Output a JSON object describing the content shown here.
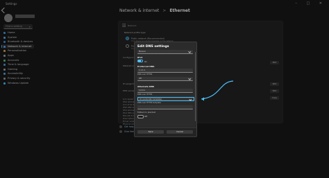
{
  "window": {
    "title": "Settings"
  },
  "sidebar": {
    "user_name": "",
    "search_placeholder": "Find a setting",
    "items": [
      {
        "label": "Home",
        "icon": "home-icon",
        "color": "#4aa0e8"
      },
      {
        "label": "System",
        "icon": "system-icon",
        "color": "#5ab0f0"
      },
      {
        "label": "Bluetooth & devices",
        "icon": "bluetooth-icon",
        "color": "#4a8fe0"
      },
      {
        "label": "Network & internet",
        "icon": "wifi-icon",
        "color": "#5fa8f2"
      },
      {
        "label": "Personalization",
        "icon": "brush-icon",
        "color": "#e0a860"
      },
      {
        "label": "Apps",
        "icon": "apps-icon",
        "color": "#9aa7b8"
      },
      {
        "label": "Accounts",
        "icon": "person-icon",
        "color": "#52c38a"
      },
      {
        "label": "Time & language",
        "icon": "clock-icon",
        "color": "#4fa2e6"
      },
      {
        "label": "Gaming",
        "icon": "gamepad-icon",
        "color": "#a8a8a8"
      },
      {
        "label": "Accessibility",
        "icon": "accessibility-icon",
        "color": "#5aa6ef"
      },
      {
        "label": "Privacy & security",
        "icon": "shield-icon",
        "color": "#9a9a9a"
      },
      {
        "label": "Windows Update",
        "icon": "update-icon",
        "color": "#4cc2ff"
      }
    ]
  },
  "breadcrumb": {
    "parent": "Network & internet",
    "separator": ">",
    "current": "Ethernet"
  },
  "ethernet_card": {
    "network_label": "Network",
    "profile_type_label": "Network profile type",
    "public_label": "Public network (Recommended)",
    "public_desc": "Your device is not discoverable on the network.",
    "private_label": "Private network",
    "private_desc": "Your device is discoverable on the network.",
    "rows": [
      {
        "label": "Configure firewall and security settings"
      },
      {
        "label": "Metered connection"
      },
      {
        "label": "IP assignment:"
      },
      {
        "label": "DNS server assignment:"
      }
    ],
    "edit_label": "Edit",
    "copy_label": "Copy",
    "properties": [
      "Link speed (Receive/Transmit):",
      "IPv6 address:",
      "Link-local IPv6 address:",
      "IPv6 DNS servers:",
      "IPv4 address:",
      "IPv4 DNS servers:",
      "Manufacturer:",
      "Description:",
      "Driver version:",
      "Physical address (MAC):"
    ]
  },
  "help": {
    "get_help": "Get help",
    "give_feedback": "Give feedback"
  },
  "dialog": {
    "title": "Edit DNS settings",
    "mode": "Manual",
    "ipv4_heading": "IPv4",
    "ipv4_state": "On",
    "preferred_heading": "Preferred DNS",
    "preferred_value": "1.1.1.1",
    "doh_label": "DNS over HTTPS",
    "doh_value": "Off",
    "alternate_heading": "Alternate DNS",
    "alternate_value": "1.0.0.1",
    "alt_doh_label": "DNS over HTTPS",
    "alt_doh_value": "On (automatic template)",
    "template_label": "DNS over HTTPS template",
    "fallback_label": "Fallback to plaintext",
    "fallback_value": "Off",
    "save_label": "Save",
    "cancel_label": "Cancel"
  },
  "annotation": {
    "color": "#4cc2ff"
  }
}
